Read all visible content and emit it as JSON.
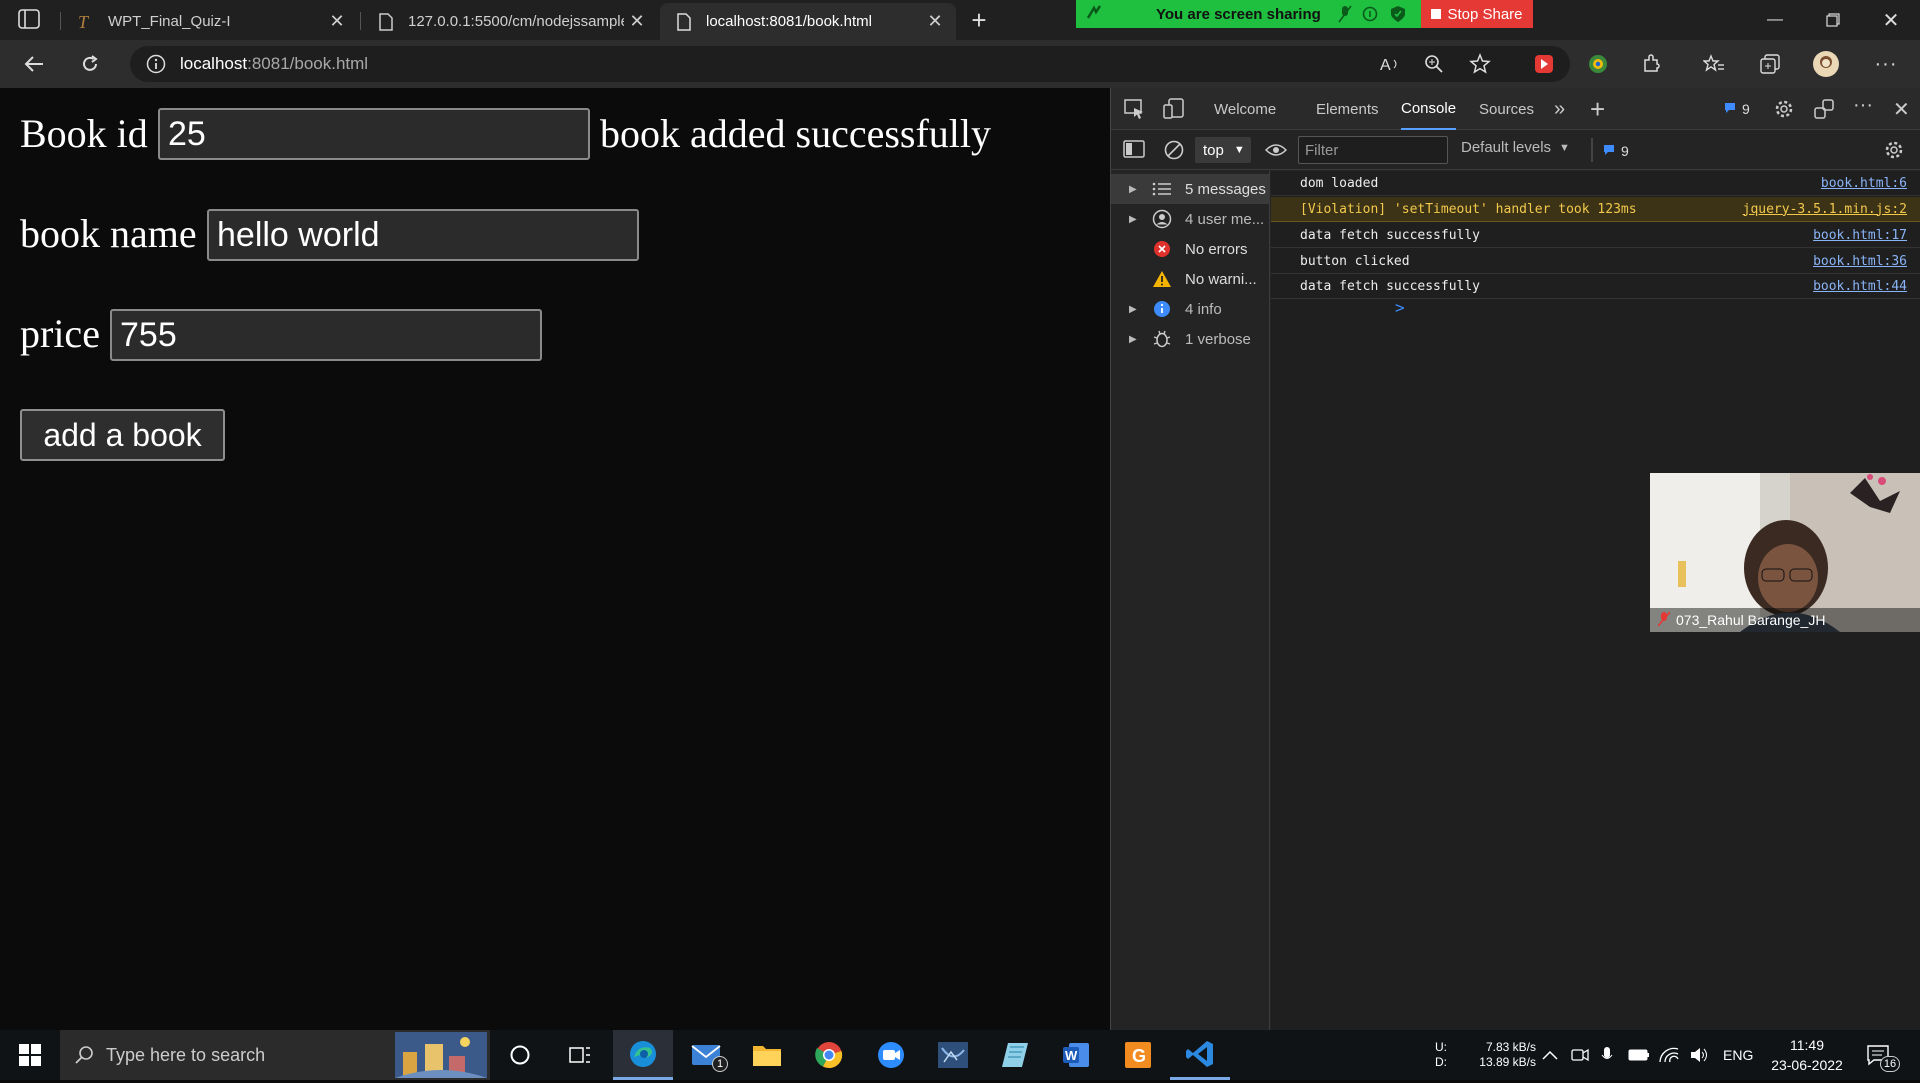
{
  "browser": {
    "tabs": [
      {
        "title": "WPT_Final_Quiz-I",
        "active": false
      },
      {
        "title": "127.0.0.1:5500/cm/nodejssample",
        "active": false
      },
      {
        "title": "localhost:8081/book.html",
        "active": true
      }
    ],
    "new_tab_symbol": "+",
    "share_banner": {
      "text": "You are screen sharing",
      "stop_label": "Stop Share"
    },
    "address": {
      "host": "localhost",
      "path": ":8081/book.html"
    }
  },
  "page": {
    "book_id_label": "Book id",
    "book_id_value": "25",
    "status_message": "book added successfully",
    "book_name_label": "book name",
    "book_name_value": "hello world",
    "price_label": "price",
    "price_value": "755",
    "add_button_label": "add a book"
  },
  "devtools": {
    "tabs": [
      "Welcome",
      "Elements",
      "Console",
      "Sources"
    ],
    "active_tab": "Console",
    "issues_count": "9",
    "context": "top",
    "filter_placeholder": "Filter",
    "levels_label": "Default levels",
    "levels_count": "9",
    "sidebar": [
      {
        "label": "5 messages",
        "icon": "list-icon",
        "expandable": true
      },
      {
        "label": "4 user me...",
        "icon": "user-icon",
        "expandable": true
      },
      {
        "label": "No errors",
        "icon": "error-icon",
        "expandable": false
      },
      {
        "label": "No warni...",
        "icon": "warning-icon",
        "expandable": false
      },
      {
        "label": "4 info",
        "icon": "info-icon",
        "expandable": true
      },
      {
        "label": "1 verbose",
        "icon": "bug-icon",
        "expandable": true
      }
    ],
    "logs": [
      {
        "message": "dom loaded",
        "source": "book.html:6",
        "level": "log"
      },
      {
        "message": "[Violation] 'setTimeout' handler took 123ms",
        "source": "jquery-3.5.1.min.js:2",
        "level": "warn"
      },
      {
        "message": "data fetch successfully",
        "source": "book.html:17",
        "level": "log"
      },
      {
        "message": "button clicked",
        "source": "book.html:36",
        "level": "log"
      },
      {
        "message": "data fetch successfully",
        "source": "book.html:44",
        "level": "log"
      }
    ],
    "prompt_symbol": ">"
  },
  "webcam": {
    "name": "073_Rahul Barange_JH"
  },
  "taskbar": {
    "search_placeholder": "Type here to search",
    "mail_badge": "1",
    "net_up_label": "U:",
    "net_down_label": "D:",
    "net_up": "7.83 kB/s",
    "net_down": "13.89 kB/s",
    "language": "ENG",
    "time": "11:49",
    "date": "23-06-2022",
    "notification_count": "16"
  }
}
